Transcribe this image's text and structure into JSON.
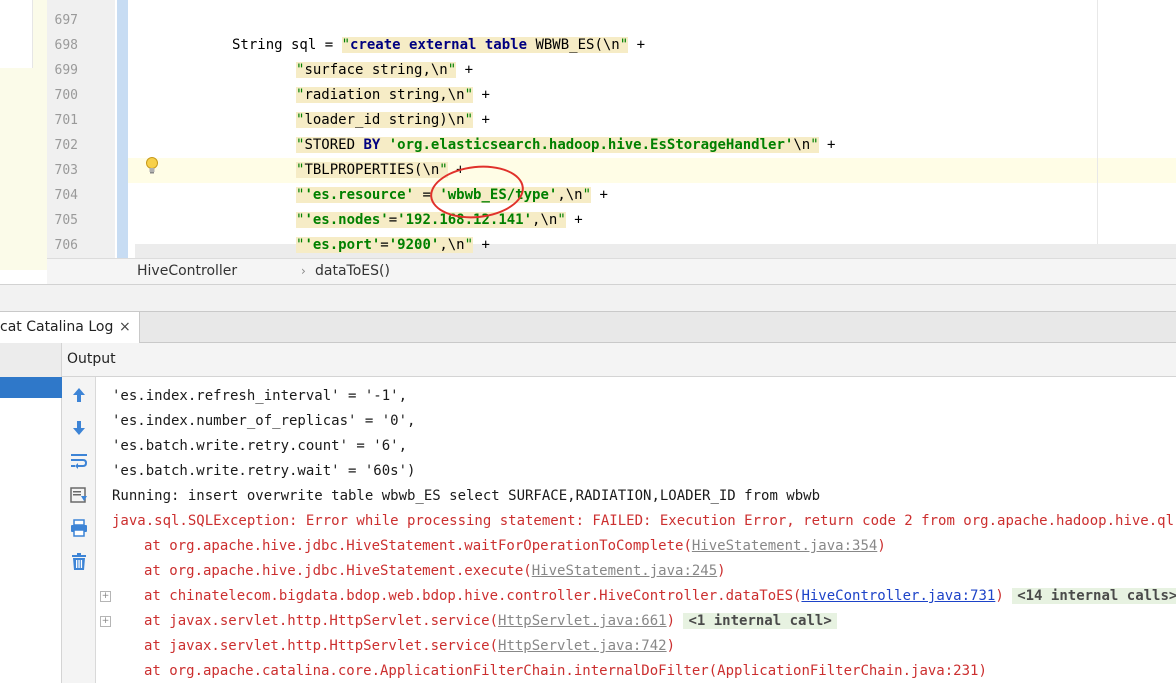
{
  "editor": {
    "line_numbers": [
      "697",
      "698",
      "699",
      "700",
      "701",
      "702",
      "703",
      "704",
      "705",
      "706"
    ],
    "lines": [
      {
        "segments": []
      },
      {
        "segments": [
          {
            "t": "String sql = ",
            "c": "plain"
          },
          {
            "t": "\"",
            "c": "strq"
          },
          {
            "t": "create external table ",
            "c": "kw-bg"
          },
          {
            "t": "WBWB_ES(\\n",
            "c": "bg"
          },
          {
            "t": "\"",
            "c": "strq"
          },
          {
            "t": " +",
            "c": "plain"
          }
        ]
      },
      {
        "segments": [
          {
            "t": "\"",
            "c": "strq"
          },
          {
            "t": "surface string,\\n",
            "c": "bg"
          },
          {
            "t": "\"",
            "c": "strq"
          },
          {
            "t": " +",
            "c": "plain"
          }
        ]
      },
      {
        "segments": [
          {
            "t": "\"",
            "c": "strq"
          },
          {
            "t": "radiation string,\\n",
            "c": "bg"
          },
          {
            "t": "\"",
            "c": "strq"
          },
          {
            "t": " +",
            "c": "plain"
          }
        ]
      },
      {
        "segments": [
          {
            "t": "\"",
            "c": "strq"
          },
          {
            "t": "loader_id string)\\n",
            "c": "bg"
          },
          {
            "t": "\"",
            "c": "strq"
          },
          {
            "t": " +",
            "c": "plain"
          }
        ]
      },
      {
        "segments": [
          {
            "t": "\"",
            "c": "strq"
          },
          {
            "t": "STORED ",
            "c": "bg"
          },
          {
            "t": "BY ",
            "c": "kw-bg"
          },
          {
            "t": "'org.elasticsearch.hadoop.hive.EsStorageHandler'",
            "c": "str-bg"
          },
          {
            "t": "\\n",
            "c": "bg"
          },
          {
            "t": "\"",
            "c": "strq"
          },
          {
            "t": " +",
            "c": "plain"
          }
        ]
      },
      {
        "segments": [
          {
            "t": "\"",
            "c": "strq"
          },
          {
            "t": "TBLPROPERTIES(\\n",
            "c": "bg"
          },
          {
            "t": "\"",
            "c": "strq"
          },
          {
            "t": " +",
            "c": "plain"
          }
        ]
      },
      {
        "segments": [
          {
            "t": "\"",
            "c": "strq"
          },
          {
            "t": "'es.resource'",
            "c": "str-bg"
          },
          {
            "t": " = ",
            "c": "bg"
          },
          {
            "t": "'wbwb_ES/type'",
            "c": "str-bg"
          },
          {
            "t": ",\\n",
            "c": "bg"
          },
          {
            "t": "\"",
            "c": "strq"
          },
          {
            "t": " +",
            "c": "plain"
          }
        ]
      },
      {
        "segments": [
          {
            "t": "\"",
            "c": "strq"
          },
          {
            "t": "'es.nodes'",
            "c": "str-bg"
          },
          {
            "t": "=",
            "c": "bg"
          },
          {
            "t": "'192.168.12.141'",
            "c": "str-bg"
          },
          {
            "t": ",\\n",
            "c": "bg"
          },
          {
            "t": "\"",
            "c": "strq"
          },
          {
            "t": " +",
            "c": "plain"
          }
        ]
      },
      {
        "segments": [
          {
            "t": "\"",
            "c": "strq"
          },
          {
            "t": "'es.port'",
            "c": "str-bg"
          },
          {
            "t": "=",
            "c": "bg"
          },
          {
            "t": "'9200'",
            "c": "str-bg"
          },
          {
            "t": ",\\n",
            "c": "bg"
          },
          {
            "t": "\"",
            "c": "strq"
          },
          {
            "t": " +",
            "c": "plain"
          }
        ]
      }
    ]
  },
  "breadcrumb": {
    "class_name": "HiveController",
    "separator": "›",
    "method_name": "dataToES()"
  },
  "tool_window": {
    "tab_label": "cat Catalina Log",
    "tab_close": "×",
    "output_title": "Output"
  },
  "console": {
    "lines": [
      {
        "type": "plain",
        "text": "'es.index.refresh_interval' = '-1',"
      },
      {
        "type": "plain",
        "text": "'es.index.number_of_replicas' = '0',"
      },
      {
        "type": "plain",
        "text": "'es.batch.write.retry.count' = '6',"
      },
      {
        "type": "plain",
        "text": "'es.batch.write.retry.wait' = '60s')"
      },
      {
        "type": "plain",
        "text": "Running: insert overwrite table wbwb_ES select SURFACE,RADIATION,LOADER_ID from wbwb"
      },
      {
        "type": "error",
        "text": "java.sql.SQLException: Error while processing statement: FAILED: Execution Error, return code 2 from org.apache.hadoop.hive.ql.exec.m"
      },
      {
        "type": "stack",
        "text": "at org.apache.hive.jdbc.HiveStatement.waitForOperationToComplete(",
        "link": "HiveStatement.java:354",
        "after": ")"
      },
      {
        "type": "stack",
        "text": "at org.apache.hive.jdbc.HiveStatement.execute(",
        "link": "HiveStatement.java:245",
        "after": ")"
      },
      {
        "type": "stack",
        "text": "at chinatelecom.bigdata.bdop.web.bdop.hive.controller.HiveController.dataToES(",
        "link": "HiveController.java:731",
        "link_blue": true,
        "after": ") ",
        "badge": "<14 internal calls>",
        "fold": "+"
      },
      {
        "type": "stack",
        "text": "at javax.servlet.http.HttpServlet.service(",
        "link": "HttpServlet.java:661",
        "after": ") ",
        "badge": "<1 internal call>",
        "fold": "+"
      },
      {
        "type": "stack",
        "text": "at javax.servlet.http.HttpServlet.service(",
        "link": "HttpServlet.java:742",
        "after": ")"
      },
      {
        "type": "stack",
        "text": "at org.apache.catalina.core.ApplicationFilterChain.internalDoFilter(ApplicationFilterChain.java:231)"
      }
    ]
  },
  "toolbar_icons": [
    "arrow-up-icon",
    "arrow-down-icon",
    "soft-wrap-icon",
    "scroll-to-end-icon",
    "print-icon",
    "trash-icon"
  ],
  "colors": {
    "keyword": "#000080",
    "string": "#008000",
    "error": "#cc2f2f",
    "selection": "#2f78c9",
    "annotation": "#e0312b"
  }
}
